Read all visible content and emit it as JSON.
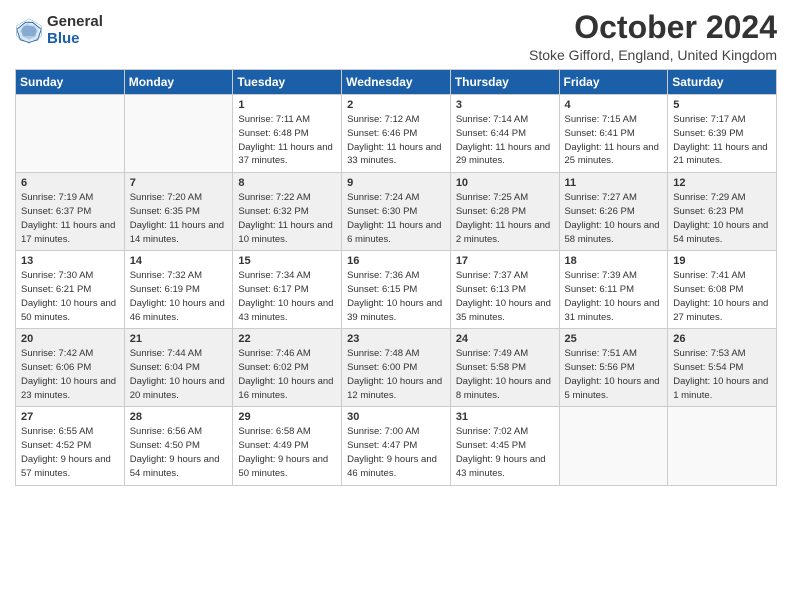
{
  "logo": {
    "general": "General",
    "blue": "Blue"
  },
  "title": "October 2024",
  "location": "Stoke Gifford, England, United Kingdom",
  "days_of_week": [
    "Sunday",
    "Monday",
    "Tuesday",
    "Wednesday",
    "Thursday",
    "Friday",
    "Saturday"
  ],
  "weeks": [
    [
      {
        "day": "",
        "info": ""
      },
      {
        "day": "",
        "info": ""
      },
      {
        "day": "1",
        "info": "Sunrise: 7:11 AM\nSunset: 6:48 PM\nDaylight: 11 hours and 37 minutes."
      },
      {
        "day": "2",
        "info": "Sunrise: 7:12 AM\nSunset: 6:46 PM\nDaylight: 11 hours and 33 minutes."
      },
      {
        "day": "3",
        "info": "Sunrise: 7:14 AM\nSunset: 6:44 PM\nDaylight: 11 hours and 29 minutes."
      },
      {
        "day": "4",
        "info": "Sunrise: 7:15 AM\nSunset: 6:41 PM\nDaylight: 11 hours and 25 minutes."
      },
      {
        "day": "5",
        "info": "Sunrise: 7:17 AM\nSunset: 6:39 PM\nDaylight: 11 hours and 21 minutes."
      }
    ],
    [
      {
        "day": "6",
        "info": "Sunrise: 7:19 AM\nSunset: 6:37 PM\nDaylight: 11 hours and 17 minutes."
      },
      {
        "day": "7",
        "info": "Sunrise: 7:20 AM\nSunset: 6:35 PM\nDaylight: 11 hours and 14 minutes."
      },
      {
        "day": "8",
        "info": "Sunrise: 7:22 AM\nSunset: 6:32 PM\nDaylight: 11 hours and 10 minutes."
      },
      {
        "day": "9",
        "info": "Sunrise: 7:24 AM\nSunset: 6:30 PM\nDaylight: 11 hours and 6 minutes."
      },
      {
        "day": "10",
        "info": "Sunrise: 7:25 AM\nSunset: 6:28 PM\nDaylight: 11 hours and 2 minutes."
      },
      {
        "day": "11",
        "info": "Sunrise: 7:27 AM\nSunset: 6:26 PM\nDaylight: 10 hours and 58 minutes."
      },
      {
        "day": "12",
        "info": "Sunrise: 7:29 AM\nSunset: 6:23 PM\nDaylight: 10 hours and 54 minutes."
      }
    ],
    [
      {
        "day": "13",
        "info": "Sunrise: 7:30 AM\nSunset: 6:21 PM\nDaylight: 10 hours and 50 minutes."
      },
      {
        "day": "14",
        "info": "Sunrise: 7:32 AM\nSunset: 6:19 PM\nDaylight: 10 hours and 46 minutes."
      },
      {
        "day": "15",
        "info": "Sunrise: 7:34 AM\nSunset: 6:17 PM\nDaylight: 10 hours and 43 minutes."
      },
      {
        "day": "16",
        "info": "Sunrise: 7:36 AM\nSunset: 6:15 PM\nDaylight: 10 hours and 39 minutes."
      },
      {
        "day": "17",
        "info": "Sunrise: 7:37 AM\nSunset: 6:13 PM\nDaylight: 10 hours and 35 minutes."
      },
      {
        "day": "18",
        "info": "Sunrise: 7:39 AM\nSunset: 6:11 PM\nDaylight: 10 hours and 31 minutes."
      },
      {
        "day": "19",
        "info": "Sunrise: 7:41 AM\nSunset: 6:08 PM\nDaylight: 10 hours and 27 minutes."
      }
    ],
    [
      {
        "day": "20",
        "info": "Sunrise: 7:42 AM\nSunset: 6:06 PM\nDaylight: 10 hours and 23 minutes."
      },
      {
        "day": "21",
        "info": "Sunrise: 7:44 AM\nSunset: 6:04 PM\nDaylight: 10 hours and 20 minutes."
      },
      {
        "day": "22",
        "info": "Sunrise: 7:46 AM\nSunset: 6:02 PM\nDaylight: 10 hours and 16 minutes."
      },
      {
        "day": "23",
        "info": "Sunrise: 7:48 AM\nSunset: 6:00 PM\nDaylight: 10 hours and 12 minutes."
      },
      {
        "day": "24",
        "info": "Sunrise: 7:49 AM\nSunset: 5:58 PM\nDaylight: 10 hours and 8 minutes."
      },
      {
        "day": "25",
        "info": "Sunrise: 7:51 AM\nSunset: 5:56 PM\nDaylight: 10 hours and 5 minutes."
      },
      {
        "day": "26",
        "info": "Sunrise: 7:53 AM\nSunset: 5:54 PM\nDaylight: 10 hours and 1 minute."
      }
    ],
    [
      {
        "day": "27",
        "info": "Sunrise: 6:55 AM\nSunset: 4:52 PM\nDaylight: 9 hours and 57 minutes."
      },
      {
        "day": "28",
        "info": "Sunrise: 6:56 AM\nSunset: 4:50 PM\nDaylight: 9 hours and 54 minutes."
      },
      {
        "day": "29",
        "info": "Sunrise: 6:58 AM\nSunset: 4:49 PM\nDaylight: 9 hours and 50 minutes."
      },
      {
        "day": "30",
        "info": "Sunrise: 7:00 AM\nSunset: 4:47 PM\nDaylight: 9 hours and 46 minutes."
      },
      {
        "day": "31",
        "info": "Sunrise: 7:02 AM\nSunset: 4:45 PM\nDaylight: 9 hours and 43 minutes."
      },
      {
        "day": "",
        "info": ""
      },
      {
        "day": "",
        "info": ""
      }
    ]
  ]
}
